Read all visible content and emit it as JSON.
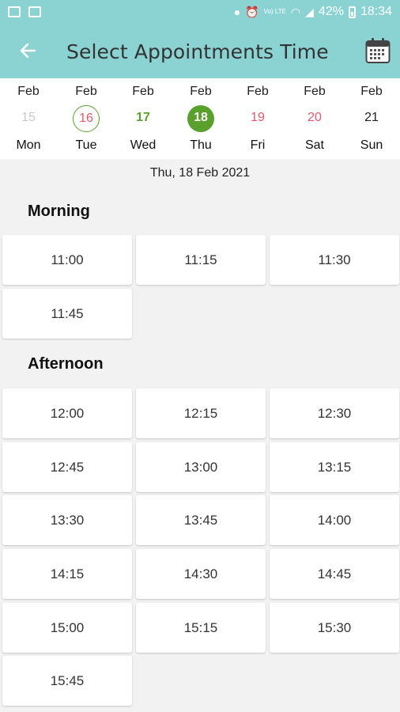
{
  "status_bar": {
    "battery": "42%",
    "time": "18:34",
    "network_label": "Vo) LTE"
  },
  "header": {
    "title": "Select Appointments Time"
  },
  "dates": [
    {
      "month": "Feb",
      "day": "15",
      "weekday": "Mon",
      "state": "past",
      "color": "#c8c8c8"
    },
    {
      "month": "Feb",
      "day": "16",
      "weekday": "Tue",
      "state": "today",
      "color": "#e2596b"
    },
    {
      "month": "Feb",
      "day": "17",
      "weekday": "Wed",
      "state": "available",
      "color": "#5aa02c"
    },
    {
      "month": "Feb",
      "day": "18",
      "weekday": "Thu",
      "state": "selected",
      "color": "#5aa02c"
    },
    {
      "month": "Feb",
      "day": "19",
      "weekday": "Fri",
      "state": "unavailable",
      "color": "#e2596b"
    },
    {
      "month": "Feb",
      "day": "20",
      "weekday": "Sat",
      "state": "unavailable",
      "color": "#e2596b"
    },
    {
      "month": "Feb",
      "day": "21",
      "weekday": "Sun",
      "state": "default",
      "color": "#222222"
    }
  ],
  "selected_date_label": "Thu, 18 Feb 2021",
  "sections": [
    {
      "title": "Morning",
      "slots": [
        "11:00",
        "11:15",
        "11:30",
        "11:45"
      ]
    },
    {
      "title": "Afternoon",
      "slots": [
        "12:00",
        "12:15",
        "12:30",
        "12:45",
        "13:00",
        "13:15",
        "13:30",
        "13:45",
        "14:00",
        "14:15",
        "14:30",
        "14:45",
        "15:00",
        "15:15",
        "15:30",
        "15:45"
      ]
    }
  ],
  "colors": {
    "header_bg": "#8bd3d3",
    "accent_green": "#5aa02c",
    "accent_red": "#e2596b"
  }
}
